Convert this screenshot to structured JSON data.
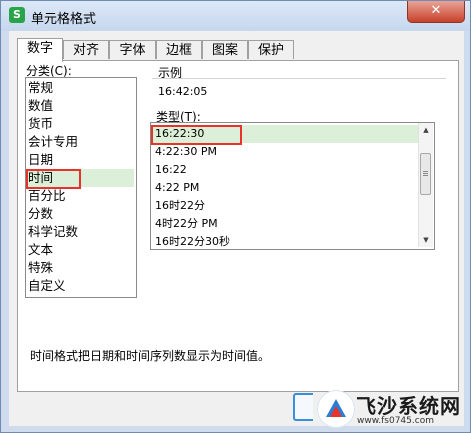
{
  "window": {
    "title": "单元格格式",
    "close_glyph": "✕",
    "app_icon_glyph": "S"
  },
  "tabs": [
    {
      "label": "数字"
    },
    {
      "label": "对齐"
    },
    {
      "label": "字体"
    },
    {
      "label": "边框"
    },
    {
      "label": "图案"
    },
    {
      "label": "保护"
    }
  ],
  "category": {
    "label": "分类(C):",
    "items": [
      "常规",
      "数值",
      "货币",
      "会计专用",
      "日期",
      "时间",
      "百分比",
      "分数",
      "科学记数",
      "文本",
      "特殊",
      "自定义"
    ],
    "selected": "时间"
  },
  "sample": {
    "label": "示例",
    "value": "16:42:05"
  },
  "type": {
    "label": "类型(T):",
    "items": [
      "16:22:30",
      "4:22:30 PM",
      "16:22",
      "4:22 PM",
      "16时22分",
      "4时22分 PM",
      "16时22分30秒"
    ],
    "selected": "16:22:30"
  },
  "description": "时间格式把日期和时间序列数显示为时间值。",
  "watermark": {
    "brand": "飞沙系统网",
    "url": "www.fs0745.com"
  },
  "colors": {
    "selection": "#dcefd8",
    "highlight_box": "#e8322a",
    "button_focus": "#3a8fd8"
  }
}
